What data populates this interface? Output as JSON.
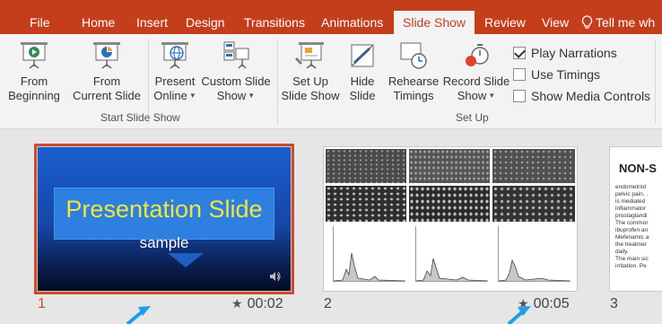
{
  "tabs": [
    {
      "label": "File"
    },
    {
      "label": "Home"
    },
    {
      "label": "Insert"
    },
    {
      "label": "Design"
    },
    {
      "label": "Transitions"
    },
    {
      "label": "Animations"
    },
    {
      "label": "Slide Show",
      "active": true
    },
    {
      "label": "Review"
    },
    {
      "label": "View"
    }
  ],
  "tell_me": "Tell me wh",
  "ribbon": {
    "start": {
      "group_label": "Start Slide Show",
      "from_beginning": [
        "From",
        "Beginning"
      ],
      "from_current": [
        "From",
        "Current Slide"
      ],
      "present_online": [
        "Present",
        "Online"
      ],
      "custom_show": [
        "Custom Slide",
        "Show"
      ]
    },
    "setup": {
      "group_label": "Set Up",
      "set_up": [
        "Set Up",
        "Slide Show"
      ],
      "hide": [
        "Hide",
        "Slide"
      ],
      "rehearse": [
        "Rehearse",
        "Timings"
      ],
      "record": [
        "Record Slide",
        "Show"
      ],
      "play_narrations": "Play Narrations",
      "use_timings": "Use Timings",
      "show_media_controls": "Show Media Controls"
    }
  },
  "checkboxes": {
    "play_narrations": true,
    "use_timings": false,
    "show_media_controls": false
  },
  "slides": [
    {
      "number": "1",
      "timing": "00:02",
      "title": "Presentation Slide",
      "subtitle": "sample",
      "selected": true
    },
    {
      "number": "2",
      "timing": "00:05"
    },
    {
      "number": "3",
      "title": "NON-S",
      "lines": [
        "endometriot",
        "pelvic pain. .",
        "is mediated",
        "inflammator",
        "prostaglandi",
        "The commor",
        "ibuprofen an",
        "Mefenamic a",
        "the treatmer",
        "daily.",
        "The main sic",
        "irritation. Pe"
      ]
    }
  ],
  "colors": {
    "accent": "#c43e1c",
    "selection": "#d04a2a",
    "title_yellow": "#f2e63a"
  }
}
